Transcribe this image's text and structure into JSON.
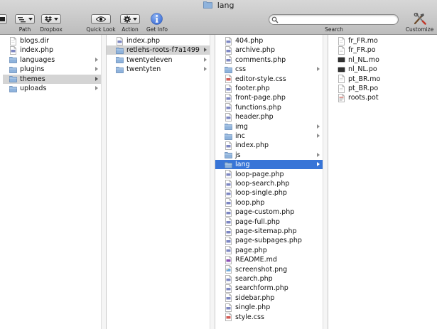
{
  "window": {
    "title": "lang"
  },
  "toolbar": {
    "path_label": "Path",
    "dropbox_label": "Dropbox",
    "quicklook_label": "Quick Look",
    "action_label": "Action",
    "getinfo_label": "Get Info",
    "search_label": "Search",
    "customize_label": "Customize",
    "search_value": ""
  },
  "columns": [
    {
      "items": [
        {
          "label": "blogs.dir",
          "kind": "doc",
          "has_arrow": false,
          "selected": ""
        },
        {
          "label": "index.php",
          "kind": "php",
          "has_arrow": false,
          "selected": ""
        },
        {
          "label": "languages",
          "kind": "folder",
          "has_arrow": true,
          "selected": ""
        },
        {
          "label": "plugins",
          "kind": "folder",
          "has_arrow": true,
          "selected": ""
        },
        {
          "label": "themes",
          "kind": "folder",
          "has_arrow": true,
          "selected": "gray"
        },
        {
          "label": "uploads",
          "kind": "folder",
          "has_arrow": true,
          "selected": ""
        }
      ]
    },
    {
      "items": [
        {
          "label": "index.php",
          "kind": "php",
          "has_arrow": false,
          "selected": ""
        },
        {
          "label": "retlehs-roots-f7a1499",
          "kind": "folder",
          "has_arrow": true,
          "selected": "gray"
        },
        {
          "label": "twentyeleven",
          "kind": "folder",
          "has_arrow": true,
          "selected": ""
        },
        {
          "label": "twentyten",
          "kind": "folder",
          "has_arrow": true,
          "selected": ""
        }
      ]
    },
    {
      "items": [
        {
          "label": "404.php",
          "kind": "php",
          "has_arrow": false,
          "selected": ""
        },
        {
          "label": "archive.php",
          "kind": "php",
          "has_arrow": false,
          "selected": ""
        },
        {
          "label": "comments.php",
          "kind": "php",
          "has_arrow": false,
          "selected": ""
        },
        {
          "label": "css",
          "kind": "folder",
          "has_arrow": true,
          "selected": ""
        },
        {
          "label": "editor-style.css",
          "kind": "css",
          "has_arrow": false,
          "selected": ""
        },
        {
          "label": "footer.php",
          "kind": "php",
          "has_arrow": false,
          "selected": ""
        },
        {
          "label": "front-page.php",
          "kind": "php",
          "has_arrow": false,
          "selected": ""
        },
        {
          "label": "functions.php",
          "kind": "php",
          "has_arrow": false,
          "selected": ""
        },
        {
          "label": "header.php",
          "kind": "php",
          "has_arrow": false,
          "selected": ""
        },
        {
          "label": "img",
          "kind": "folder",
          "has_arrow": true,
          "selected": ""
        },
        {
          "label": "inc",
          "kind": "folder",
          "has_arrow": true,
          "selected": ""
        },
        {
          "label": "index.php",
          "kind": "php",
          "has_arrow": false,
          "selected": ""
        },
        {
          "label": "js",
          "kind": "folder",
          "has_arrow": true,
          "selected": ""
        },
        {
          "label": "lang",
          "kind": "folder",
          "has_arrow": true,
          "selected": "blue"
        },
        {
          "label": "loop-page.php",
          "kind": "php",
          "has_arrow": false,
          "selected": ""
        },
        {
          "label": "loop-search.php",
          "kind": "php",
          "has_arrow": false,
          "selected": ""
        },
        {
          "label": "loop-single.php",
          "kind": "php",
          "has_arrow": false,
          "selected": ""
        },
        {
          "label": "loop.php",
          "kind": "php",
          "has_arrow": false,
          "selected": ""
        },
        {
          "label": "page-custom.php",
          "kind": "php",
          "has_arrow": false,
          "selected": ""
        },
        {
          "label": "page-full.php",
          "kind": "php",
          "has_arrow": false,
          "selected": ""
        },
        {
          "label": "page-sitemap.php",
          "kind": "php",
          "has_arrow": false,
          "selected": ""
        },
        {
          "label": "page-subpages.php",
          "kind": "php",
          "has_arrow": false,
          "selected": ""
        },
        {
          "label": "page.php",
          "kind": "php",
          "has_arrow": false,
          "selected": ""
        },
        {
          "label": "README.md",
          "kind": "md",
          "has_arrow": false,
          "selected": ""
        },
        {
          "label": "screenshot.png",
          "kind": "png",
          "has_arrow": false,
          "selected": ""
        },
        {
          "label": "search.php",
          "kind": "php",
          "has_arrow": false,
          "selected": ""
        },
        {
          "label": "searchform.php",
          "kind": "php",
          "has_arrow": false,
          "selected": ""
        },
        {
          "label": "sidebar.php",
          "kind": "php",
          "has_arrow": false,
          "selected": ""
        },
        {
          "label": "single.php",
          "kind": "php",
          "has_arrow": false,
          "selected": ""
        },
        {
          "label": "style.css",
          "kind": "css",
          "has_arrow": false,
          "selected": ""
        }
      ]
    },
    {
      "items": [
        {
          "label": "fr_FR.mo",
          "kind": "doc",
          "has_arrow": false,
          "selected": ""
        },
        {
          "label": "fr_FR.po",
          "kind": "doc",
          "has_arrow": false,
          "selected": ""
        },
        {
          "label": "nl_NL.mo",
          "kind": "dark",
          "has_arrow": false,
          "selected": ""
        },
        {
          "label": "nl_NL.po",
          "kind": "dark",
          "has_arrow": false,
          "selected": ""
        },
        {
          "label": "pt_BR.mo",
          "kind": "doc",
          "has_arrow": false,
          "selected": ""
        },
        {
          "label": "pt_BR.po",
          "kind": "doc",
          "has_arrow": false,
          "selected": ""
        },
        {
          "label": "roots.pot",
          "kind": "pot",
          "has_arrow": false,
          "selected": ""
        }
      ]
    }
  ],
  "colors": {
    "selection_blue": "#3875d7",
    "selection_gray": "#d4d4d4",
    "folder_blue": "#8fb3dc",
    "info_blue": "#3e6fd6"
  }
}
